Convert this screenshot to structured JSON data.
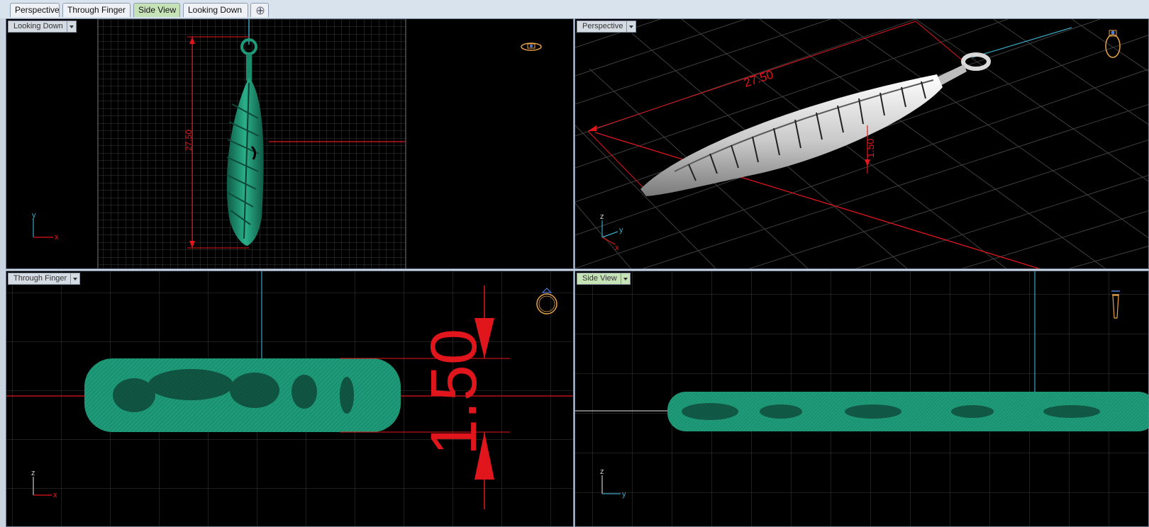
{
  "tabs": [
    {
      "label": "Perspective",
      "active": false
    },
    {
      "label": "Through Finger",
      "active": false
    },
    {
      "label": "Side View",
      "active": true
    },
    {
      "label": "Looking Down",
      "active": false
    }
  ],
  "viewports": {
    "top_left": {
      "label": "Looking Down",
      "dimension": "27.50",
      "axes": {
        "vertical": "y",
        "horizontal": "x"
      }
    },
    "top_right": {
      "label": "Perspective",
      "dimension_length": "27.50",
      "dimension_thickness": "1.50",
      "axes": {
        "vertical": "z",
        "a": "y",
        "b": "x"
      }
    },
    "bottom_left": {
      "label": "Through Finger",
      "dimension": "1.50",
      "axes": {
        "vertical": "z",
        "horizontal": "x"
      }
    },
    "bottom_right": {
      "label": "Side View",
      "axes": {
        "vertical": "z",
        "horizontal": "y"
      }
    }
  },
  "colors": {
    "dimension": "#e0161c",
    "model_green": "#1f9a78",
    "grid": "#3a3a3a",
    "axis_cyan": "#3aa7c4",
    "tab_active": "#c6e3b8"
  },
  "icons": [
    "ring-icon",
    "add-tab-icon",
    "dropdown-arrow-icon"
  ]
}
